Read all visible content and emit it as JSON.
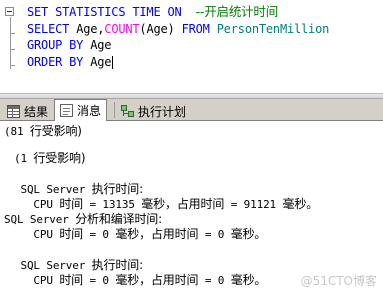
{
  "editor": {
    "line1": {
      "kw": "SET STATISTICS TIME ON",
      "comment": "--开启统计时间"
    },
    "line2": {
      "kw_select": "SELECT",
      "col": "Age,",
      "fn": "COUNT",
      "args": "(Age)",
      "kw_from": "FROM",
      "table": "PersonTenMillion"
    },
    "line3": {
      "kw": "GROUP BY",
      "col": "Age"
    },
    "line4": {
      "kw": "ORDER BY",
      "col": "Age"
    }
  },
  "tabs": [
    {
      "label": "结果",
      "icon": "results-grid-icon",
      "active": false
    },
    {
      "label": "消息",
      "icon": "messages-icon",
      "active": true
    },
    {
      "label": "执行计划",
      "icon": "execution-plan-icon",
      "active": false
    }
  ],
  "messages": {
    "rows1_count": "(81 ",
    "rows1_text": "行受影响)",
    "rows2_count": "(1 ",
    "rows2_text": "行受影响)",
    "exec1": {
      "head_a": " SQL Server ",
      "head_b": "执行时间:",
      "cpu_a": "   CPU ",
      "cpu_b": "时间",
      "cpu_c": " = 13135 ",
      "cpu_d": "毫秒，占用时间",
      "cpu_e": " = 91121 ",
      "cpu_f": "毫秒。"
    },
    "parse": {
      "head_a": "SQL Server ",
      "head_b": "分析和编译时间:",
      "cpu_a": "   CPU ",
      "cpu_b": "时间",
      "cpu_c": " = 0 ",
      "cpu_d": "毫秒，占用时间",
      "cpu_e": " = 0 ",
      "cpu_f": "毫秒。"
    },
    "exec2": {
      "head_a": " SQL Server ",
      "head_b": "执行时间:",
      "cpu_a": "   CPU ",
      "cpu_b": "时间",
      "cpu_c": " = 0 ",
      "cpu_d": "毫秒，占用时间",
      "cpu_e": " = 0 ",
      "cpu_f": "毫秒。"
    }
  },
  "watermark": "@51CTO博客",
  "colors": {
    "keyword": "#0000ff",
    "function": "#ff00ff",
    "object": "#008080",
    "comment": "#008000",
    "tabbar_bg": "#d4d0c8"
  }
}
